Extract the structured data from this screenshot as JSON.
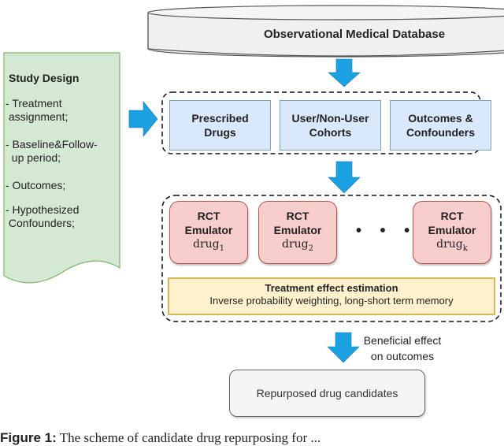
{
  "database": {
    "label": "Observational  Medical Database"
  },
  "study_design": {
    "title": "Study Design",
    "items": [
      "- Treatment\n assignment;",
      "- Baseline&Follow-\n  up period;",
      "- Outcomes;",
      "- Hypothesized\n Confounders;"
    ]
  },
  "extraction": {
    "boxes": [
      {
        "label": "Prescribed\nDrugs"
      },
      {
        "label": "User/Non-User\nCohorts"
      },
      {
        "label": "Outcomes &\nConfounders"
      }
    ]
  },
  "emulators": {
    "items": [
      {
        "title": "RCT\nEmulator",
        "drug": "drug",
        "sub": "1"
      },
      {
        "title": "RCT\nEmulator",
        "drug": "drug",
        "sub": "2"
      },
      {
        "title": "RCT\nEmulator",
        "drug": "drug",
        "sub": "k"
      }
    ],
    "ellipsis": "• • •"
  },
  "estimation": {
    "title": "Treatment effect estimation",
    "subtitle": "Inverse probability weighting, long-short term memory"
  },
  "arrow_label": "Beneficial effect\non outcomes",
  "result": {
    "label": "Repurposed drug candidates"
  },
  "caption": {
    "prefix": "Figure 1:",
    "text": "The scheme of candidate drug repurposing for ..."
  },
  "colors": {
    "arrow": "#1ba1e2",
    "blue_fill": "#dae8fc",
    "red_fill": "#f8cecc",
    "yellow_fill": "#fff2cc",
    "green_fill": "#d5e8d4"
  }
}
